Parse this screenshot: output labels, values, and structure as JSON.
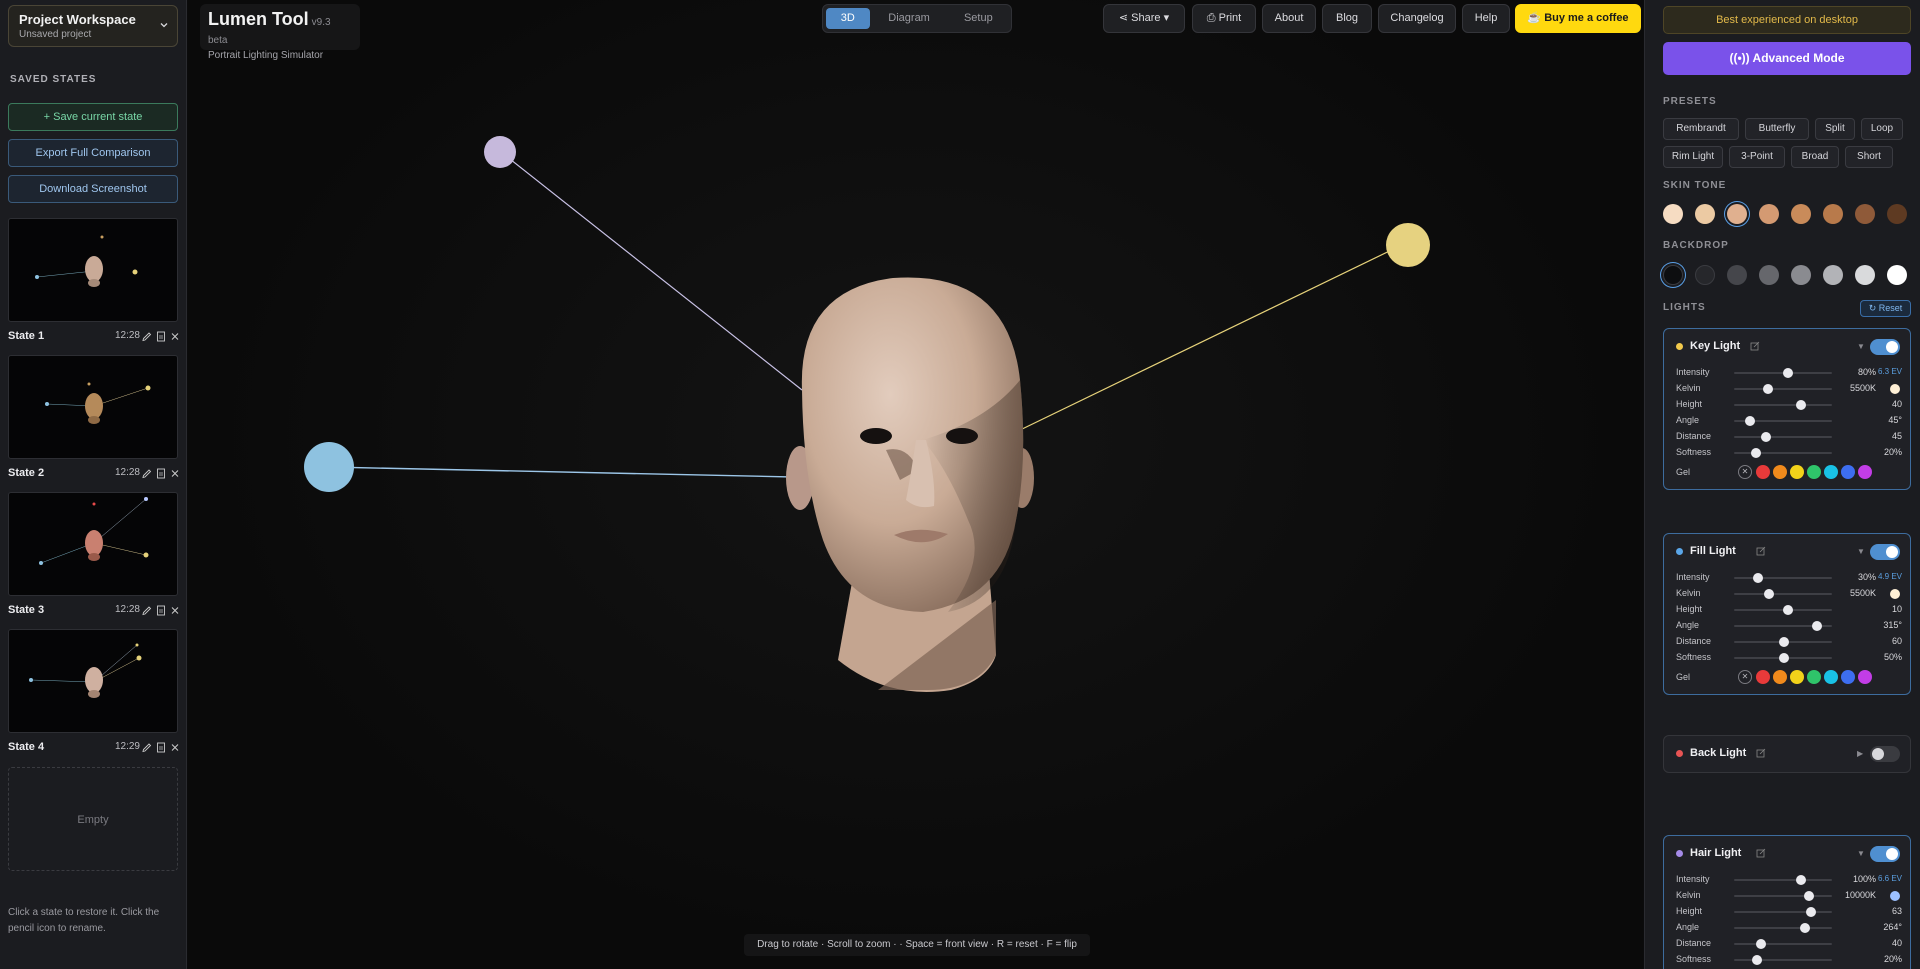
{
  "project": {
    "title": "Project Workspace",
    "subtitle": "Unsaved project"
  },
  "left": {
    "saved_states_label": "SAVED STATES",
    "save_btn": "+ Save current state",
    "export_btn": "Export Full Comparison",
    "download_btn": "Download Screenshot",
    "states": [
      {
        "name": "State 1",
        "time": "12:28"
      },
      {
        "name": "State 2",
        "time": "12:28"
      },
      {
        "name": "State 3",
        "time": "12:28"
      },
      {
        "name": "State 4",
        "time": "12:29"
      }
    ],
    "empty_label": "Empty",
    "hint": "Click a state to restore it. Click the pencil icon to rename."
  },
  "header": {
    "app_name": "Lumen Tool",
    "version": "v9.3 beta",
    "subtitle": "Portrait Lighting Simulator",
    "tabs": [
      "3D",
      "Diagram",
      "Setup"
    ],
    "buttons": {
      "share": "Share",
      "print": "Print",
      "about": "About",
      "blog": "Blog",
      "changelog": "Changelog",
      "help": "Help",
      "coffee": "Buy me a coffee"
    }
  },
  "viewport": {
    "hint": "Drag to rotate · Scroll to zoom · · Space = front view · R = reset · F = flip"
  },
  "right": {
    "best": "Best experienced on desktop",
    "advanced": "Advanced Mode",
    "presets_label": "PRESETS",
    "presets": [
      "Rembrandt",
      "Butterfly",
      "Split",
      "Loop",
      "Rim Light",
      "3-Point",
      "Broad",
      "Short"
    ],
    "skin_label": "SKIN TONE",
    "skin_tones": [
      "#f6dcc2",
      "#eccaa3",
      "#e0b08f",
      "#d49a72",
      "#c98b5a",
      "#b87a4b",
      "#8f5a39",
      "#5e3a22"
    ],
    "skin_selected": 2,
    "backdrop_label": "BACKDROP",
    "backdrops": [
      "#0d0e10",
      "#26272b",
      "#45464b",
      "#66676c",
      "#8a8b90",
      "#b2b3b7",
      "#d9dadc",
      "#ffffff"
    ],
    "backdrop_selected": 0,
    "lights_label": "LIGHTS",
    "reset": "Reset",
    "gel_colors": [
      "#e83a3a",
      "#f08a1c",
      "#f2d21a",
      "#2fc46a",
      "#19c2e6",
      "#3d6ef0",
      "#c23de6"
    ],
    "lights": [
      {
        "name": "Key Light",
        "dot": "#f2c94c",
        "on": true,
        "ev": "6.3 EV",
        "kelvin_color": "#fff0d6",
        "intensity": "80%",
        "kelvin": "5500K",
        "height": "40",
        "angle": "45°",
        "distance": "45",
        "softness": "20%",
        "levels": [
          0.55,
          0.35,
          0.68,
          0.16,
          0.33,
          0.22
        ]
      },
      {
        "name": "Fill Light",
        "dot": "#5aa6e8",
        "on": true,
        "ev": "4.9 EV",
        "kelvin_color": "#fff0d6",
        "intensity": "30%",
        "kelvin": "5500K",
        "height": "10",
        "angle": "315°",
        "distance": "60",
        "softness": "50%",
        "levels": [
          0.24,
          0.36,
          0.55,
          0.85,
          0.51,
          0.51
        ]
      },
      {
        "name": "Back Light",
        "dot": "#e85454",
        "on": false
      },
      {
        "name": "Hair Light",
        "dot": "#a58be8",
        "on": true,
        "ev": "6.6 EV",
        "kelvin_color": "#9cc0ff",
        "intensity": "100%",
        "kelvin": "10000K",
        "height": "63",
        "angle": "264°",
        "distance": "40",
        "softness": "20%",
        "levels": [
          0.68,
          0.77,
          0.79,
          0.72,
          0.28,
          0.23
        ]
      }
    ],
    "labels": {
      "intensity": "Intensity",
      "kelvin": "Kelvin",
      "height": "Height",
      "angle": "Angle",
      "distance": "Distance",
      "softness": "Softness",
      "gel": "Gel"
    }
  }
}
